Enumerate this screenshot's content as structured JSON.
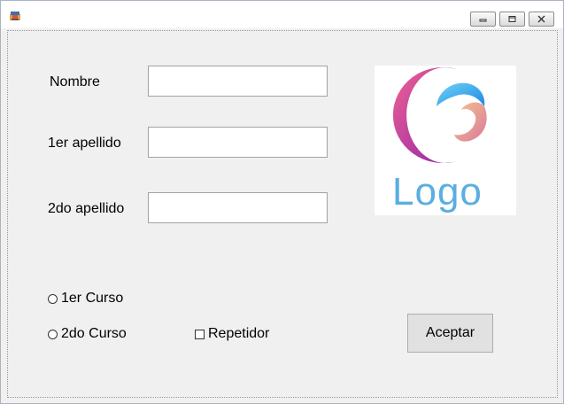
{
  "window": {
    "title": "",
    "controls": {
      "minimize_icon": "minimize-icon",
      "restore_icon": "restore-icon",
      "close_icon": "close-icon"
    }
  },
  "form": {
    "nombre_label": "Nombre",
    "nombre_value": "",
    "apellido1_label": "1er apellido",
    "apellido1_value": "",
    "apellido2_label": "2do apellido",
    "apellido2_value": "",
    "logo_text": "Logo",
    "curso1_label": "1er Curso",
    "curso2_label": "2do Curso",
    "repetidor_label": "Repetidor",
    "aceptar_label": "Aceptar"
  },
  "colors": {
    "window_bg": "#f0f0f0",
    "logo_text": "#5aaee0",
    "logo_crescent_start": "#f06292",
    "logo_crescent_end": "#8e24aa",
    "logo_swirl_blue": "#3fb6ea",
    "logo_swirl_peach": "#e8a27d"
  }
}
